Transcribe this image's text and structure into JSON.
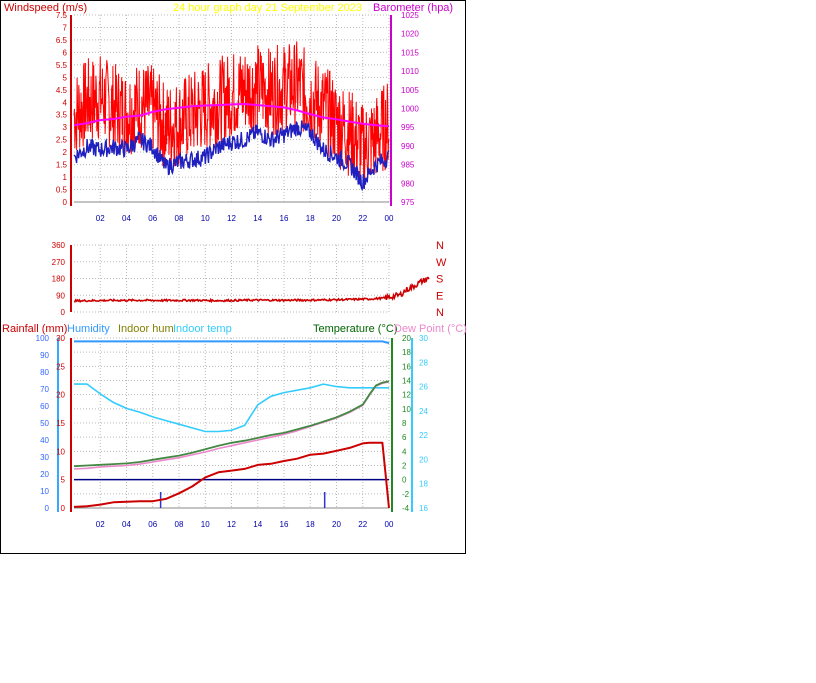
{
  "header": {
    "windspeed_label": "Windspeed (m/s)",
    "title": "24 hour graph day   21 September 2023",
    "barometer_label": "Barometer (hpa)"
  },
  "legend": {
    "rainfall": "Rainfall (mm)",
    "humidity": "Humidity",
    "indoor_hum": "Indoor hum",
    "indoor_temp": "Indoor temp",
    "temperature": "Temperature (°C)",
    "dew_point": "Dew Point (°C)"
  },
  "colors": {
    "wind": "#ff0000",
    "wind_avg": "#2020c0",
    "barometer": "#ff00ff",
    "direction": "#cc0000",
    "rainfall": "#cc0000",
    "humidity": "#3399ff",
    "indoor_hum": "#808000",
    "indoor_temp": "#33ccff",
    "temperature": "#448844",
    "dew_point": "#ee88cc",
    "title": "#ffff00",
    "zero_line": "#000080"
  },
  "chart_data": [
    {
      "type": "line",
      "panel": "wind",
      "xlabel": "",
      "x_ticks": [
        "02",
        "04",
        "06",
        "08",
        "10",
        "12",
        "14",
        "16",
        "18",
        "20",
        "22",
        "00"
      ],
      "ylim_left": [
        0,
        7.5
      ],
      "left_ticks": [
        "0",
        "0.5",
        "1",
        "1.5",
        "2",
        "2.5",
        "3",
        "3.5",
        "4",
        "4.5",
        "5",
        "5.5",
        "6",
        "6.5",
        "7",
        "7.5"
      ],
      "ylim_right": [
        975,
        1025
      ],
      "right_ticks": [
        "975",
        "980",
        "985",
        "990",
        "995",
        "1000",
        "1005",
        "1010",
        "1015",
        "1020",
        "1025"
      ],
      "x_hours": [
        0,
        1,
        2,
        3,
        4,
        5,
        6,
        7,
        8,
        9,
        10,
        11,
        12,
        13,
        14,
        15,
        16,
        17,
        18,
        19,
        20,
        21,
        22,
        23,
        24
      ],
      "series": [
        {
          "name": "gust",
          "values": [
            3.5,
            4.0,
            4.2,
            3.8,
            3.6,
            3.9,
            3.7,
            3.0,
            3.2,
            3.5,
            3.8,
            4.0,
            4.3,
            4.5,
            4.6,
            4.4,
            4.6,
            4.7,
            4.2,
            3.8,
            3.2,
            2.8,
            2.2,
            2.6,
            3.2
          ]
        },
        {
          "name": "average",
          "values": [
            1.8,
            2.2,
            2.1,
            2.2,
            2.1,
            2.5,
            2.2,
            1.4,
            1.6,
            1.7,
            1.8,
            2.2,
            2.4,
            2.5,
            2.8,
            2.5,
            2.7,
            3.0,
            2.8,
            2.1,
            1.8,
            1.5,
            0.8,
            1.5,
            1.8
          ]
        },
        {
          "name": "barometer",
          "values": [
            995.5,
            996.1,
            996.9,
            997.2,
            997.8,
            998.1,
            999.1,
            999.8,
            1000.2,
            1000.6,
            1000.8,
            1000.9,
            1001.1,
            1001.2,
            1000.9,
            1000.6,
            1000.3,
            999.5,
            998.5,
            997.6,
            997.1,
            996.5,
            995.9,
            995.5,
            995.3
          ]
        }
      ]
    },
    {
      "type": "line",
      "panel": "wind direction",
      "ylim": [
        0,
        360
      ],
      "left_ticks": [
        "0",
        "90",
        "180",
        "270",
        "360"
      ],
      "right_labels": [
        "N",
        "E",
        "S",
        "W",
        "N"
      ],
      "x_hours": [
        0,
        2,
        4,
        6,
        8,
        10,
        12,
        14,
        16,
        18,
        20,
        21,
        22,
        22.5,
        23,
        23.5,
        24
      ],
      "series": [
        {
          "name": "direction",
          "values": [
            60,
            62,
            63,
            62,
            63,
            61,
            64,
            63,
            64,
            66,
            70,
            75,
            90,
            120,
            140,
            165,
            180
          ]
        }
      ]
    },
    {
      "type": "line",
      "panel": "temperature",
      "x_ticks": [
        "02",
        "04",
        "06",
        "08",
        "10",
        "12",
        "14",
        "16",
        "18",
        "20",
        "22",
        "00"
      ],
      "humidity_ticks": [
        "0",
        "10",
        "20",
        "30",
        "40",
        "50",
        "60",
        "70",
        "80",
        "90",
        "100"
      ],
      "rain_ticks": [
        "0",
        "5",
        "10",
        "15",
        "20",
        "25",
        "30"
      ],
      "temp_ticks": [
        "-4",
        "-2",
        "0",
        "2",
        "4",
        "6",
        "8",
        "10",
        "12",
        "14",
        "16",
        "18",
        "20"
      ],
      "indoor_ticks": [
        "16",
        "18",
        "20",
        "22",
        "24",
        "26",
        "28",
        "30"
      ],
      "x_hours": [
        0,
        1,
        2,
        3,
        4,
        5,
        6,
        7,
        8,
        9,
        10,
        11,
        12,
        13,
        14,
        15,
        16,
        17,
        18,
        19,
        20,
        21,
        22,
        22.5,
        23,
        23.5,
        24
      ],
      "series": [
        {
          "name": "humidity",
          "values": [
            98,
            98,
            98,
            98,
            98,
            98,
            98,
            98,
            98,
            98,
            98,
            98,
            98,
            98,
            98,
            98,
            98,
            98,
            98,
            98,
            98,
            98,
            98,
            98,
            98,
            98,
            97
          ]
        },
        {
          "name": "indoor temp",
          "values": [
            26.2,
            26.2,
            25.4,
            24.7,
            24.2,
            23.9,
            23.5,
            23.2,
            22.9,
            22.6,
            22.3,
            22.3,
            22.4,
            22.8,
            24.5,
            25.2,
            25.5,
            25.7,
            25.9,
            26.2,
            26.0,
            25.9,
            25.9,
            25.9,
            25.9,
            25.9,
            25.9
          ]
        },
        {
          "name": "rainfall",
          "values": [
            0.2,
            0.3,
            0.6,
            1.0,
            1.1,
            1.2,
            1.2,
            1.6,
            2.6,
            3.8,
            5.4,
            6.3,
            6.6,
            6.9,
            7.6,
            7.8,
            8.3,
            8.7,
            9.4,
            9.6,
            10.1,
            10.6,
            11.4,
            11.5,
            11.5,
            11.5,
            0
          ]
        },
        {
          "name": "temperature",
          "values": [
            1.9,
            2.0,
            2.1,
            2.2,
            2.3,
            2.5,
            2.8,
            3.1,
            3.4,
            3.8,
            4.3,
            4.8,
            5.2,
            5.5,
            5.9,
            6.3,
            6.6,
            7.1,
            7.6,
            8.2,
            8.8,
            9.6,
            10.6,
            12.0,
            13.3,
            13.7,
            13.9
          ]
        },
        {
          "name": "dew point",
          "values": [
            1.5,
            1.6,
            1.8,
            1.9,
            2.0,
            2.2,
            2.5,
            2.8,
            3.1,
            3.5,
            3.9,
            4.4,
            4.8,
            5.2,
            5.6,
            6.0,
            6.4,
            6.9,
            7.5,
            8.1,
            8.7,
            9.5,
            10.5,
            11.9,
            13.2,
            13.6,
            13.8
          ]
        }
      ],
      "rain_events": [
        6.6,
        19.1
      ]
    }
  ]
}
